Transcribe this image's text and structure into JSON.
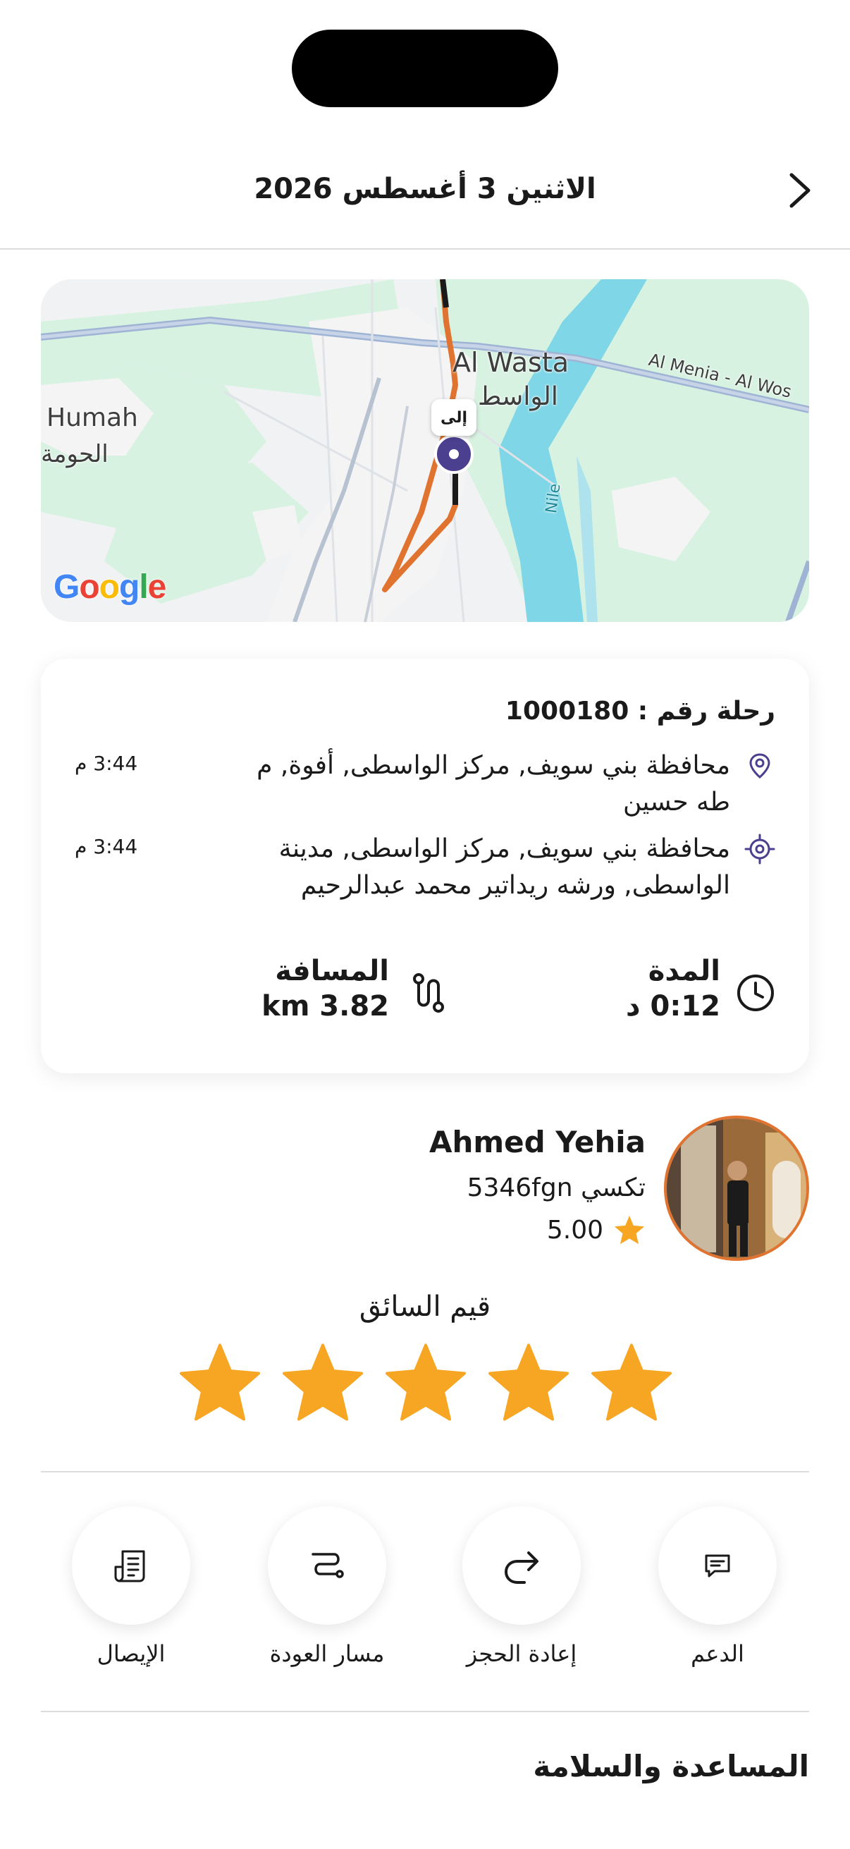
{
  "header": {
    "title": "الاثنين 3 أغسطس 2026"
  },
  "map": {
    "labels": {
      "humah_en": "Humah",
      "humah_ar": "الحومة",
      "alwasta_en": "Al Wasta",
      "alwasta_ar": "الواسط",
      "road": "Al Menia - Al Wos",
      "river": "Nile"
    },
    "destination_tag": "إلى",
    "provider": "Google"
  },
  "trip": {
    "id_label": "رحلة رقم : 1000180",
    "pickup": {
      "address": "محافظة بني سويف, مركز الواسطى, أفوة, م طه حسين",
      "time": "3:44 م"
    },
    "dropoff": {
      "address": "محافظة بني سويف, مركز الواسطى, مدينة الواسطى, ورشه ريداتير محمد عبدالرحيم",
      "time": "3:44 م"
    },
    "duration": {
      "label": "المدة",
      "value": "0:12 د"
    },
    "distance": {
      "label": "المسافة",
      "value": "km 3.82"
    }
  },
  "driver": {
    "name": "Ahmed Yehia",
    "car": "تكسي 5346fgn",
    "rating": "5.00"
  },
  "rate": {
    "title": "قيم السائق",
    "stars": 5
  },
  "actions": [
    {
      "label": "الدعم",
      "icon": "chat-icon"
    },
    {
      "label": "إعادة الحجز",
      "icon": "redo-icon"
    },
    {
      "label": "مسار العودة",
      "icon": "route-icon"
    },
    {
      "label": "الإيصال",
      "icon": "receipt-icon"
    }
  ],
  "section": {
    "title": "المساعدة والسلامة"
  },
  "colors": {
    "accent": "#F6A623",
    "route": "#E0732F",
    "pin": "#4B3F8F",
    "icon": "#4B3F8F"
  }
}
